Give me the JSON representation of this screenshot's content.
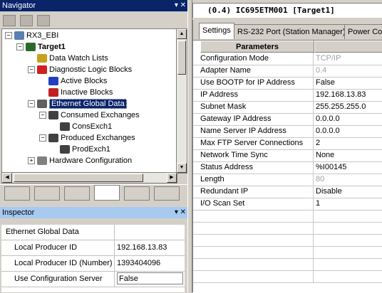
{
  "navigator": {
    "title": "Navigator",
    "title_buttons": "▾ ✕",
    "tree": [
      {
        "label": "RX3_EBI",
        "depth": 0,
        "expander": "−",
        "icon": "computer-icon"
      },
      {
        "label": "Target1",
        "depth": 1,
        "expander": "−",
        "icon": "target-icon",
        "bold": true
      },
      {
        "label": "Data Watch Lists",
        "depth": 2,
        "expander": "",
        "icon": "glasses-icon"
      },
      {
        "label": "Diagnostic Logic Blocks",
        "depth": 2,
        "expander": "−",
        "icon": "block-icon"
      },
      {
        "label": "Active Blocks",
        "depth": 3,
        "expander": "",
        "icon": "active-block-icon"
      },
      {
        "label": "Inactive Blocks",
        "depth": 3,
        "expander": "",
        "icon": "inactive-block-icon"
      },
      {
        "label": "Ethernet Global Data",
        "depth": 2,
        "expander": "−",
        "icon": "network-icon",
        "selected": true
      },
      {
        "label": "Consumed Exchanges",
        "depth": 3,
        "expander": "−",
        "icon": "exchange-icon"
      },
      {
        "label": "ConsExch1",
        "depth": 4,
        "expander": "",
        "icon": "exchange-item-icon"
      },
      {
        "label": "Produced Exchanges",
        "depth": 3,
        "expander": "−",
        "icon": "exchange-icon"
      },
      {
        "label": "ProdExch1",
        "depth": 4,
        "expander": "",
        "icon": "exchange-item-icon"
      },
      {
        "label": "Hardware Configuration",
        "depth": 2,
        "expander": "+",
        "icon": "hardware-icon"
      }
    ]
  },
  "inspector": {
    "title": "Inspector",
    "title_buttons": "▾ ✕",
    "section": "Ethernet Global Data",
    "rows": [
      {
        "name": "Local Producer ID",
        "value": "192.168.13.83"
      },
      {
        "name": "Local Producer ID (Number)",
        "value": "1393404096"
      },
      {
        "name": "Use Configuration Server",
        "value": "False"
      }
    ]
  },
  "document": {
    "title": "(0.4) IC695ETM001 [Target1]",
    "tabs": [
      "Settings",
      "RS-232 Port (Station Manager)",
      "Power Co"
    ],
    "active_tab": "Settings",
    "header": "Parameters",
    "params": [
      {
        "name": "Configuration Mode",
        "value": "TCP/IP",
        "dim": true
      },
      {
        "name": "Adapter Name",
        "value": "0.4",
        "dim": true
      },
      {
        "name": "Use BOOTP for IP Address",
        "value": "False"
      },
      {
        "name": "IP Address",
        "value": "192.168.13.83"
      },
      {
        "name": "Subnet Mask",
        "value": "255.255.255.0"
      },
      {
        "name": "Gateway IP Address",
        "value": "0.0.0.0"
      },
      {
        "name": "Name Server IP Address",
        "value": "0.0.0.0"
      },
      {
        "name": "Max FTP Server Connections",
        "value": "2"
      },
      {
        "name": "Network Time Sync",
        "value": "None"
      },
      {
        "name": "Status Address",
        "value": "%I00145"
      },
      {
        "name": "Length",
        "value": "80",
        "dim": true
      },
      {
        "name": "Redundant IP",
        "value": "Disable"
      },
      {
        "name": "I/O Scan Set",
        "value": "1"
      }
    ]
  }
}
